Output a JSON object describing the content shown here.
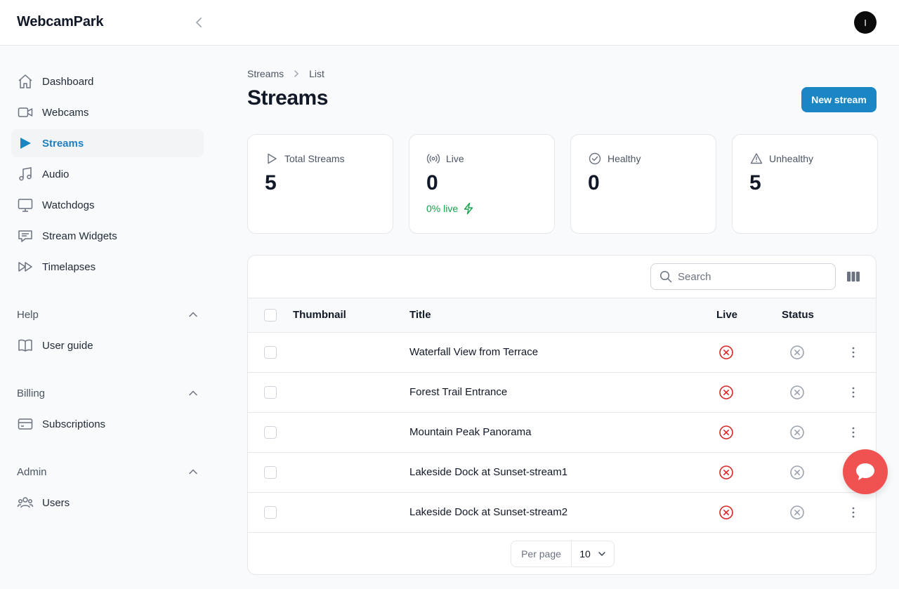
{
  "app": {
    "brand": "WebcamPark",
    "avatar_initial": "I"
  },
  "sidebar": {
    "items": [
      {
        "label": "Dashboard",
        "icon": "home-icon"
      },
      {
        "label": "Webcams",
        "icon": "video-camera-icon"
      },
      {
        "label": "Streams",
        "icon": "play-icon",
        "active": true
      },
      {
        "label": "Audio",
        "icon": "music-note-icon"
      },
      {
        "label": "Watchdogs",
        "icon": "monitor-icon"
      },
      {
        "label": "Stream Widgets",
        "icon": "chat-bubble-icon"
      },
      {
        "label": "Timelapses",
        "icon": "fast-forward-icon"
      }
    ],
    "groups": [
      {
        "label": "Help",
        "items": [
          {
            "label": "User guide",
            "icon": "book-icon"
          }
        ]
      },
      {
        "label": "Billing",
        "items": [
          {
            "label": "Subscriptions",
            "icon": "credit-card-icon"
          }
        ]
      },
      {
        "label": "Admin",
        "items": [
          {
            "label": "Users",
            "icon": "users-icon"
          }
        ]
      }
    ]
  },
  "breadcrumb": {
    "parent": "Streams",
    "current": "List"
  },
  "page": {
    "title": "Streams",
    "new_button": "New stream"
  },
  "stats": [
    {
      "label": "Total Streams",
      "value": "5",
      "icon": "play-outline-icon"
    },
    {
      "label": "Live",
      "value": "0",
      "sub": "0% live",
      "icon": "broadcast-icon"
    },
    {
      "label": "Healthy",
      "value": "0",
      "icon": "check-circle-icon"
    },
    {
      "label": "Unhealthy",
      "value": "5",
      "icon": "warning-triangle-icon"
    }
  ],
  "table": {
    "search_placeholder": "Search",
    "columns": {
      "thumbnail": "Thumbnail",
      "title": "Title",
      "live": "Live",
      "status": "Status"
    },
    "rows": [
      {
        "title": "Waterfall View from Terrace"
      },
      {
        "title": "Forest Trail Entrance"
      },
      {
        "title": "Mountain Peak Panorama"
      },
      {
        "title": "Lakeside Dock at Sunset-stream1"
      },
      {
        "title": "Lakeside Dock at Sunset-stream2"
      }
    ],
    "pagination": {
      "per_page_label": "Per page",
      "per_page_value": "10"
    }
  },
  "colors": {
    "accent": "#1a86c4",
    "live_red": "#dc2626",
    "status_gray": "#9ca3af",
    "success": "#16a34a",
    "chat": "#f05252"
  }
}
